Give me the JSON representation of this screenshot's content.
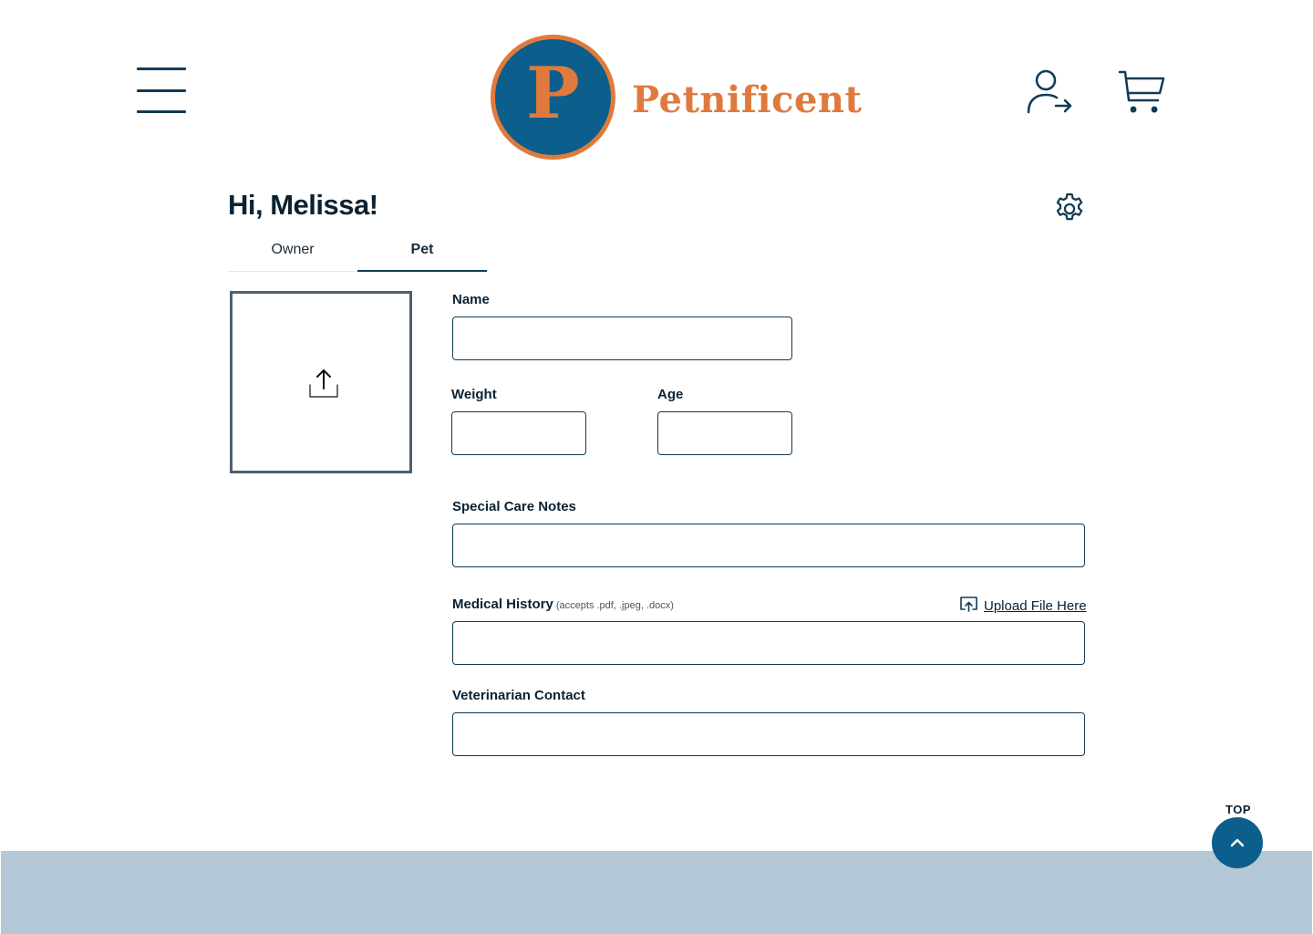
{
  "header": {
    "brand_letter": "P",
    "brand_name": "Petnificent",
    "menu_icon": "hamburger-menu-icon",
    "login_icon": "user-login-icon",
    "cart_icon": "shopping-cart-icon"
  },
  "profile": {
    "greeting": "Hi, Melissa!",
    "settings_icon": "gear-icon"
  },
  "tabs": [
    {
      "label": "Owner",
      "active": false
    },
    {
      "label": "Pet",
      "active": true
    }
  ],
  "form": {
    "photo_upload_icon": "upload-arrow-icon",
    "name": {
      "label": "Name",
      "value": ""
    },
    "weight": {
      "label": "Weight",
      "value": ""
    },
    "age": {
      "label": "Age",
      "value": ""
    },
    "special_care": {
      "label": "Special Care Notes",
      "value": ""
    },
    "medical_history": {
      "label": "Medical History",
      "hint": "(accepts .pdf, .jpeg, .docx)",
      "upload_label": "Upload File Here",
      "upload_icon": "cloud-upload-icon",
      "value": ""
    },
    "vet_contact": {
      "label": "Veterinarian Contact",
      "value": ""
    }
  },
  "back_to_top": {
    "label": "TOP",
    "icon": "chevron-up-icon"
  },
  "colors": {
    "primary": "#0c5f8c",
    "accent": "#e07a3c",
    "text": "#0a2233",
    "footer": "#b4c8d7"
  }
}
